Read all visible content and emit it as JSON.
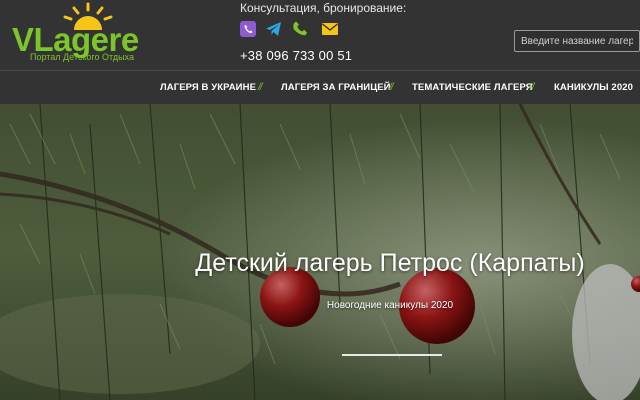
{
  "brand": {
    "logo_text": "VLagere",
    "tagline": "Портал Детского Отдыха",
    "accent_color": "#7cc52a",
    "sun_color": "#f5c518"
  },
  "contacts": {
    "label": "Консультация, бронирование:",
    "phone": "+38 096 733 00 51",
    "icons": [
      {
        "name": "viber-icon",
        "color": "#8e5bd3"
      },
      {
        "name": "telegram-icon",
        "color": "#2ca5e0"
      },
      {
        "name": "phone-icon",
        "color": "#7cc52a"
      },
      {
        "name": "mail-icon",
        "color": "#f5c518"
      }
    ]
  },
  "search": {
    "placeholder": "Введите название лагеря..."
  },
  "nav": {
    "items": [
      {
        "label": "ЛАГЕРЯ В УКРАИНЕ"
      },
      {
        "label": "ЛАГЕРЯ ЗА ГРАНИЦЕЙ"
      },
      {
        "label": "ТЕМАТИЧЕСКИЕ ЛАГЕРЯ"
      },
      {
        "label": "КАНИКУЛЫ 2020"
      }
    ],
    "separator": "//"
  },
  "hero": {
    "title": "Детский лагерь Петрос (Карпаты)",
    "subtitle": "Новогодние каникулы 2020"
  }
}
